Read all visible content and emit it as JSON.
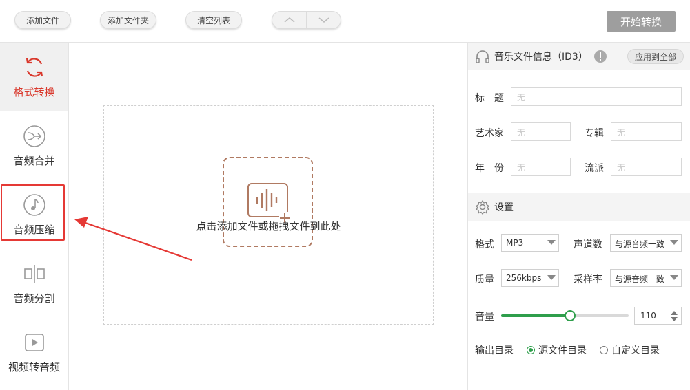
{
  "toolbar": {
    "add_file": "添加文件",
    "add_folder": "添加文件夹",
    "clear_list": "清空列表",
    "move_up_icon": "chevron-up-icon",
    "move_down_icon": "chevron-down-icon",
    "start": "开始转换"
  },
  "sidebar": {
    "items": [
      {
        "label": "格式转换",
        "icon": "refresh-icon",
        "active": true
      },
      {
        "label": "音频合并",
        "icon": "merge-icon"
      },
      {
        "label": "音频压缩",
        "icon": "music-note-icon"
      },
      {
        "label": "音频分割",
        "icon": "split-icon"
      },
      {
        "label": "视频转音频",
        "icon": "video-play-icon"
      }
    ]
  },
  "main": {
    "drop_hint": "点击添加文件或拖拽文件到此处"
  },
  "id3": {
    "title": "音乐文件信息（ID3）",
    "apply_all": "应用到全部",
    "fields": {
      "title_label": "标　题",
      "artist_label": "艺术家",
      "album_label": "专辑",
      "year_label": "年　份",
      "genre_label": "流派",
      "placeholder": "无"
    }
  },
  "settings": {
    "title": "设置",
    "format_label": "格式",
    "format_value": "MP3",
    "channels_label": "声道数",
    "channels_value": "与源音频一致",
    "quality_label": "质量",
    "quality_value": "256kbps",
    "samplerate_label": "采样率",
    "samplerate_value": "与源音频一致",
    "volume_label": "音量",
    "volume_value": "110",
    "volume_fraction": 0.54,
    "output_label": "输出目录",
    "output_source": "源文件目录",
    "output_custom": "自定义目录",
    "output_selected": "source"
  },
  "colors": {
    "accent_red": "#d9382c",
    "accent_green": "#2e9e4b",
    "icon_brown": "#b07a62"
  }
}
